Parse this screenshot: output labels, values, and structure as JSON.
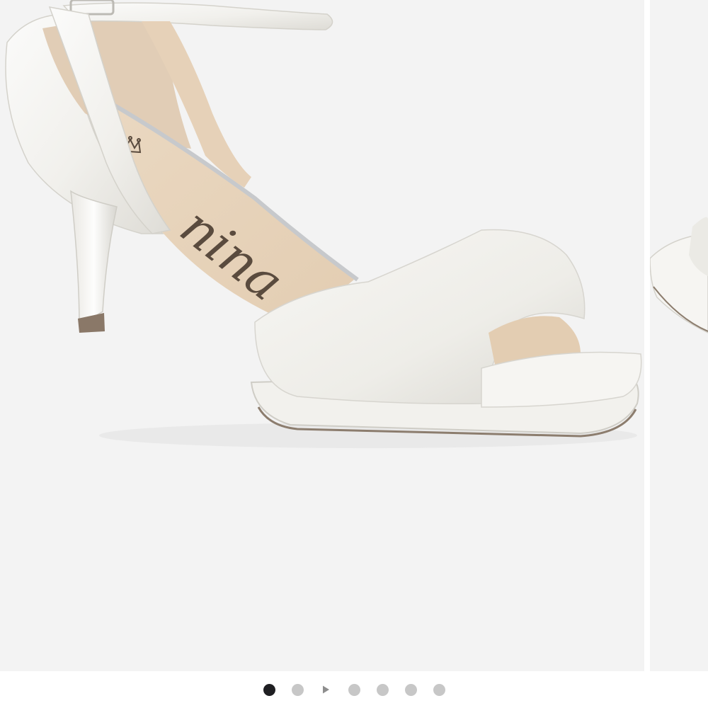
{
  "gallery": {
    "main_image": {
      "icon": "white-satin-sandal-image",
      "insole_logo_text": "nina",
      "background": "#f3f3f3"
    },
    "next_image": {
      "icon": "sandal-partial-image"
    },
    "pager": {
      "items": [
        {
          "kind": "dot",
          "active": true
        },
        {
          "kind": "dot",
          "active": false
        },
        {
          "kind": "video",
          "active": false
        },
        {
          "kind": "dot",
          "active": false
        },
        {
          "kind": "dot",
          "active": false
        },
        {
          "kind": "dot",
          "active": false
        },
        {
          "kind": "dot",
          "active": false
        }
      ],
      "active_color": "#1f1f22",
      "inactive_color": "#c7c7c7"
    }
  }
}
